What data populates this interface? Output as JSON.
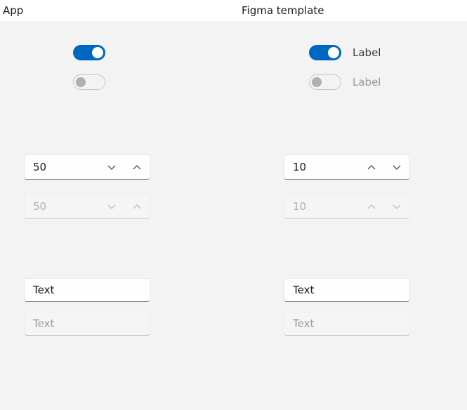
{
  "columns": {
    "app": {
      "title": "App",
      "toggles": {
        "on_label": "",
        "off_label": ""
      },
      "numberbox": {
        "value": "50",
        "disabled_value": "50"
      },
      "textbox": {
        "value": "Text",
        "disabled_value": "Text"
      },
      "spinner_order": "down-up"
    },
    "figma": {
      "title": "Figma template",
      "toggles": {
        "on_label": "Label",
        "off_label": "Label"
      },
      "numberbox": {
        "value": "10",
        "disabled_value": "10"
      },
      "textbox": {
        "value": "Text",
        "disabled_value": "Text"
      },
      "spinner_order": "up-down"
    }
  }
}
